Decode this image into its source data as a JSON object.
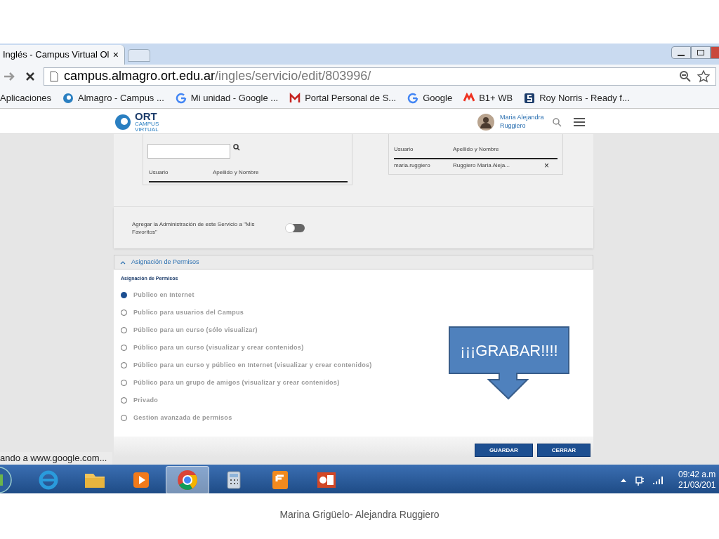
{
  "browser": {
    "tab_title": "Inglés - Campus Virtual Ol",
    "tab_close": "×",
    "url_host": "campus.almagro.ort.edu.ar",
    "url_path": "/ingles/servicio/edit/803996/",
    "bookmarks": [
      {
        "label": "Aplicaciones",
        "kind": "apps"
      },
      {
        "label": "Almagro - Campus ...",
        "kind": "ort"
      },
      {
        "label": "Mi unidad - Google ...",
        "kind": "google"
      },
      {
        "label": "Portal Personal de S...",
        "kind": "gmail"
      },
      {
        "label": "Google",
        "kind": "google"
      },
      {
        "label": "B1+ WB",
        "kind": "b1"
      },
      {
        "label": "Roy Norris - Ready f...",
        "kind": "s"
      }
    ],
    "status_text": "ando a www.google.com..."
  },
  "site_header": {
    "logo_text": "ORT",
    "logo_sub": "CAMPUS VIRTUAL",
    "user_name": "Maria Alejandra Ruggiero"
  },
  "search_box": {
    "columns": [
      "Usuario",
      "Apellido y Nombre"
    ]
  },
  "selected_users": {
    "columns": [
      "Usuario",
      "Apellido y Nombre"
    ],
    "rows": [
      {
        "user": "maria.ruggiero",
        "name": "Ruggiero Maria Aleja...",
        "remove": "×"
      }
    ]
  },
  "favorites": {
    "label": "Agregar la Administración de este Servicio a \"Mis Favoritos\"",
    "on": false
  },
  "permissions": {
    "section_title": "Asignación de Permisos",
    "expanded": true,
    "heading": "Asignación de Permisos",
    "options": [
      {
        "label": "Publico en Internet",
        "selected": true
      },
      {
        "label": "Publico para usuarios del Campus",
        "selected": false
      },
      {
        "label": "Público para un curso (sólo visualizar)",
        "selected": false
      },
      {
        "label": "Público para un curso (visualizar y crear contenidos)",
        "selected": false
      },
      {
        "label": "Público para un curso y público en Internet (visualizar y crear contenidos)",
        "selected": false
      },
      {
        "label": "Público para un grupo de amigos (visualizar y crear contenidos)",
        "selected": false
      },
      {
        "label": "Privado",
        "selected": false
      },
      {
        "label": "Gestion avanzada de permisos",
        "selected": false
      }
    ]
  },
  "buttons": [
    "GUARDAR",
    "CERRAR"
  ],
  "callout": "¡¡¡GRABAR!!!!",
  "taskbar": {
    "apps": [
      {
        "kind": "ie",
        "selected": false
      },
      {
        "kind": "folder",
        "selected": false
      },
      {
        "kind": "media",
        "selected": false
      },
      {
        "kind": "chrome",
        "selected": true
      },
      {
        "kind": "calculator",
        "selected": false
      },
      {
        "kind": "pdf",
        "selected": false
      },
      {
        "kind": "powerpoint",
        "selected": false
      }
    ],
    "time": "09:42 a.m",
    "date": "21/03/201"
  },
  "caption": "Marina Grigüelo- Alejandra Ruggiero"
}
